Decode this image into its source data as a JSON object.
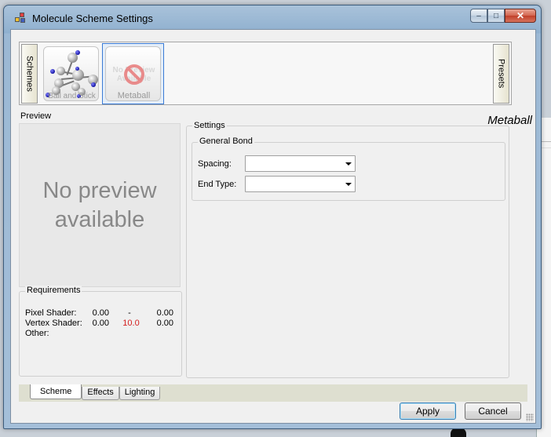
{
  "window": {
    "title": "Molecule Scheme Settings"
  },
  "caption_buttons": {
    "minimize": "–",
    "restore": "□",
    "close": "✕"
  },
  "side_tabs": {
    "left": "Schemes",
    "right": "Presets"
  },
  "schemes": [
    {
      "label": "Ball and Stick",
      "selected": false
    },
    {
      "label": "Metaball",
      "selected": true,
      "ghost_text": "No Preview Available"
    }
  ],
  "preview": {
    "title": "Preview",
    "message": "No preview available"
  },
  "requirements": {
    "title": "Requirements",
    "rows": [
      {
        "label": "Pixel Shader:",
        "min": "0.00",
        "current": "-",
        "max": "0.00"
      },
      {
        "label": "Vertex Shader:",
        "min": "0.00",
        "current": "10.0",
        "max": "0.00"
      },
      {
        "label": "Other:",
        "min": "",
        "current": "",
        "max": ""
      }
    ]
  },
  "settings": {
    "title": "Settings",
    "scheme_name": "Metaball",
    "group_title": "General Bond",
    "spacing_label": "Spacing:",
    "spacing_value": "",
    "end_type_label": "End Type:",
    "end_type_value": ""
  },
  "tabs": [
    {
      "label": "Scheme",
      "active": true
    },
    {
      "label": "Effects",
      "active": false
    },
    {
      "label": "Lighting",
      "active": false
    }
  ],
  "buttons": {
    "apply": "Apply",
    "cancel": "Cancel"
  },
  "colors": {
    "warning_value": "#d42020",
    "selection": "#3a7bd5"
  }
}
